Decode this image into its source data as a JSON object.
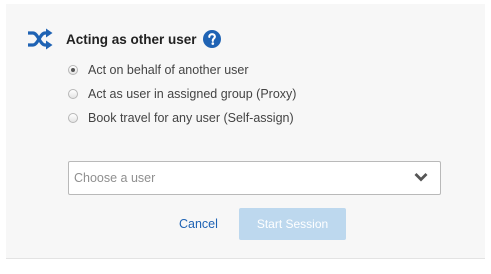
{
  "header": {
    "icon": "shuffle-icon",
    "title": "Acting as other user",
    "help_icon": "question-circle-icon",
    "accent_color": "#1f63b4"
  },
  "options": [
    {
      "label": "Act on behalf of another user",
      "checked": true
    },
    {
      "label": "Act as user in assigned group (Proxy)",
      "checked": false
    },
    {
      "label": "Book travel for any user (Self-assign)",
      "checked": false
    }
  ],
  "user_select": {
    "placeholder": "Choose a user",
    "icon": "chevron-down-icon"
  },
  "actions": {
    "cancel_label": "Cancel",
    "start_label": "Start Session",
    "start_enabled": false
  }
}
